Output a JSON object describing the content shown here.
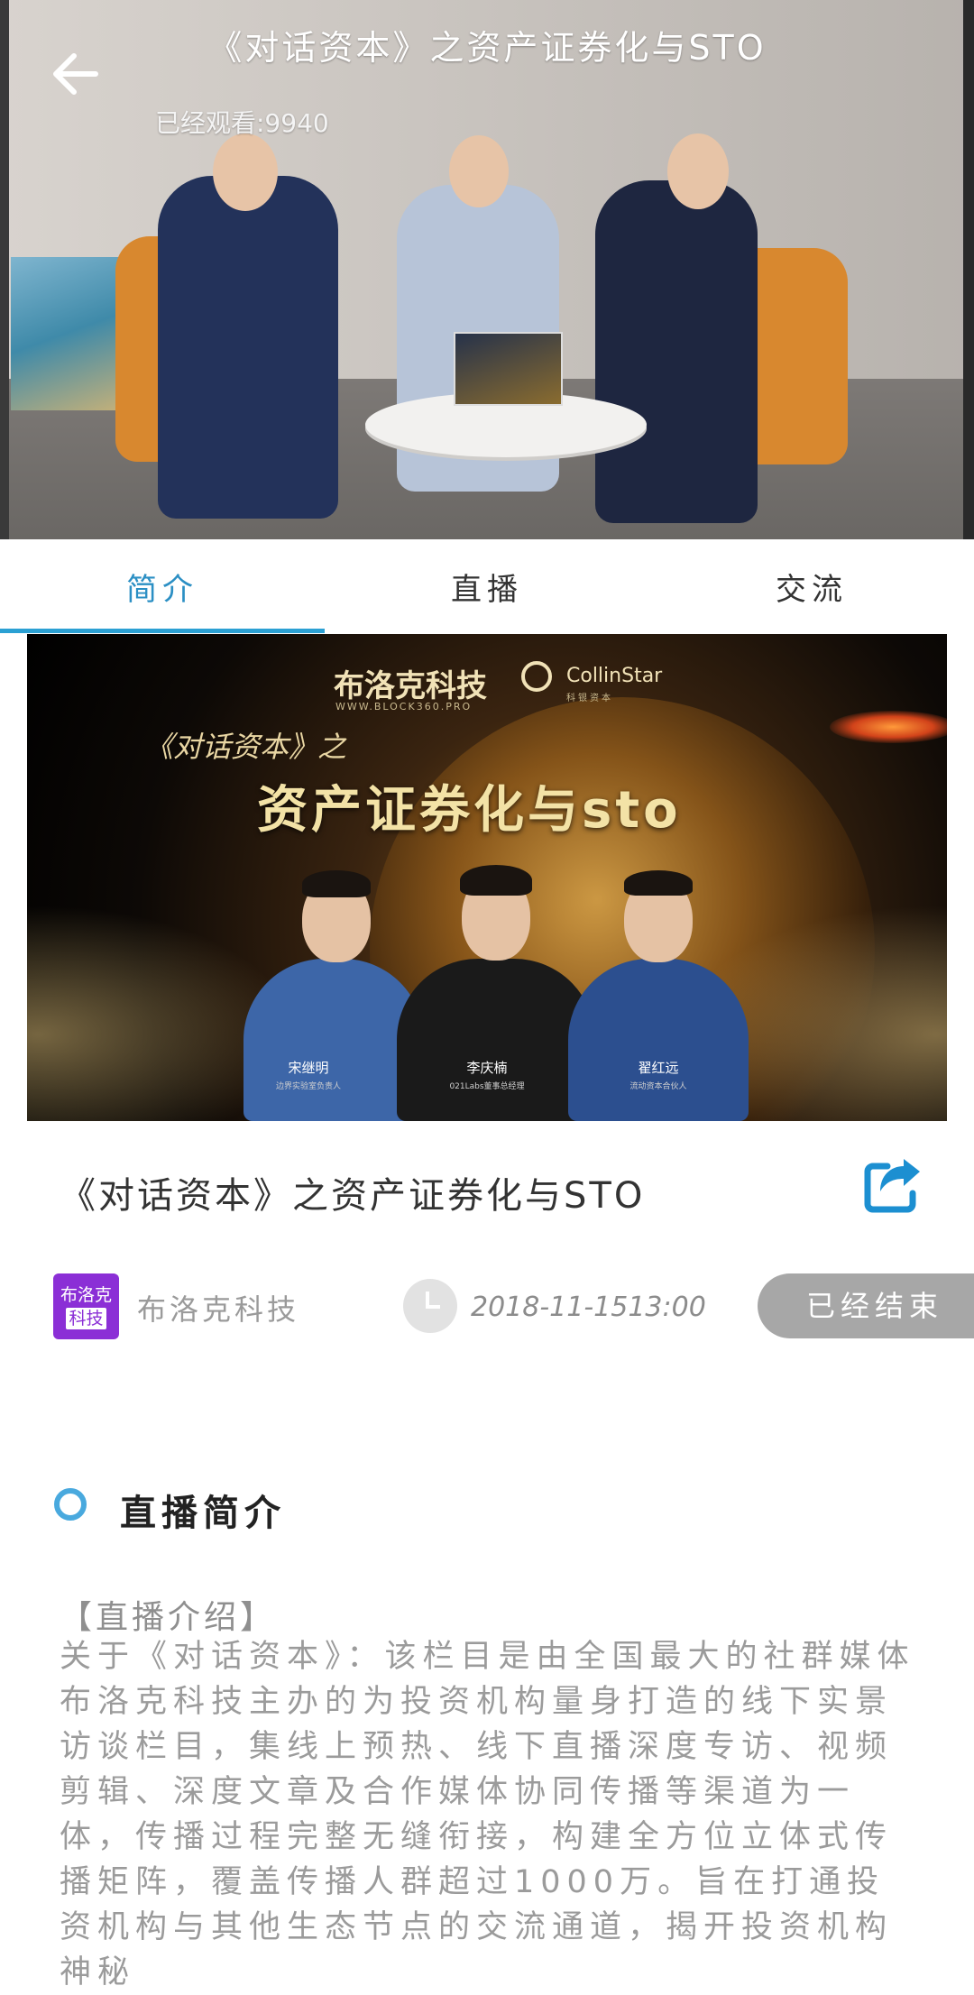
{
  "video": {
    "title": "《对话资本》之资产证券化与STO",
    "view_count": "已经观看:9940",
    "back_icon": "arrow-left-icon"
  },
  "tabs": [
    {
      "label": "简介",
      "active": true
    },
    {
      "label": "直播",
      "active": false
    },
    {
      "label": "交流",
      "active": false
    }
  ],
  "banner": {
    "brand": "布洛克科技",
    "brand_url": "WWW.BLOCK360.PRO",
    "partner": "CollinStar",
    "partner_sub": "科银资本",
    "series": "《对话资本》之",
    "headline": "资产证券化与sto",
    "guests": [
      {
        "name": "宋继明",
        "role": "边界实验室负责人"
      },
      {
        "name": "李庆楠",
        "role": "021Labs董事总经理"
      },
      {
        "name": "翟红远",
        "role": "流动资本合伙人"
      }
    ]
  },
  "article": {
    "title": "《对话资本》之资产证券化与STO",
    "share_icon": "share-icon",
    "org_logo_line1": "布洛克",
    "org_logo_line2": "科技",
    "org_name": "布洛克科技",
    "time": "2018-11-1513:00",
    "status": "已经结束"
  },
  "intro": {
    "section_title": "直播简介",
    "heading": "【直播介绍】",
    "body": "关于《对话资本》：该栏目是由全国最大的社群媒体布洛克科技主办的为投资机构量身打造的线下实景访谈栏目，集线上预热、线下直播深度专访、视频剪辑、深度文章及合作媒体协同传播等渠道为一体，传播过程完整无缝衔接，构建全方位立体式传播矩阵，覆盖传播人群超过1000万。旨在打通投资机构与其他生态节点的交流通道，揭开投资机构神秘"
  },
  "colors": {
    "accent": "#2ba0d3",
    "status_bg": "#a7a7a7",
    "org_logo_bg": "#8b2fd6"
  }
}
